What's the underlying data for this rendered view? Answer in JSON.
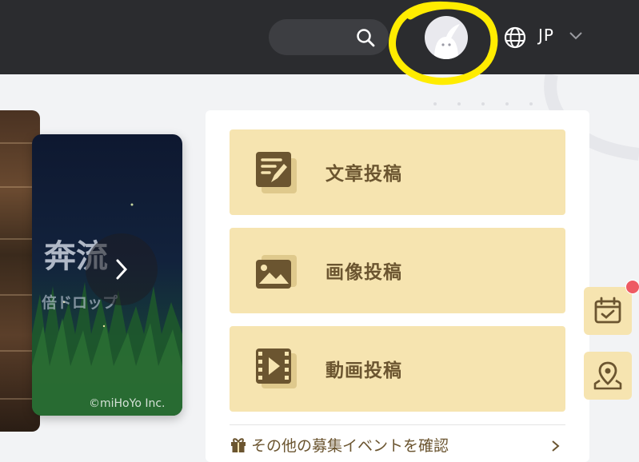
{
  "header": {
    "lang_label": "JP",
    "search_icon": "search-icon",
    "globe_icon": "globe-icon",
    "chevron_icon": "chevron-down-icon",
    "avatar_icon": "avatar",
    "highlight_color": "#ffec00",
    "bg_color": "#2b2c2f"
  },
  "banner": {
    "title": "奔流",
    "subtitle": "倍ドロップ",
    "copyright": "©miHoYo Inc.",
    "next_icon": "chevron-right-icon"
  },
  "post_panel": {
    "buttons": [
      {
        "label": "文章投稿",
        "icon": "article-edit-icon"
      },
      {
        "label": "画像投稿",
        "icon": "image-icon"
      },
      {
        "label": "動画投稿",
        "icon": "video-icon"
      }
    ],
    "more_label": "その他の募集イベントを確認",
    "more_icon": "gift-icon",
    "accent_color": "#f6e4b0",
    "text_color": "#6b5530"
  },
  "side_buttons": [
    {
      "icon": "calendar-check-icon",
      "has_notification": true
    },
    {
      "icon": "map-pin-icon",
      "has_notification": false
    }
  ]
}
